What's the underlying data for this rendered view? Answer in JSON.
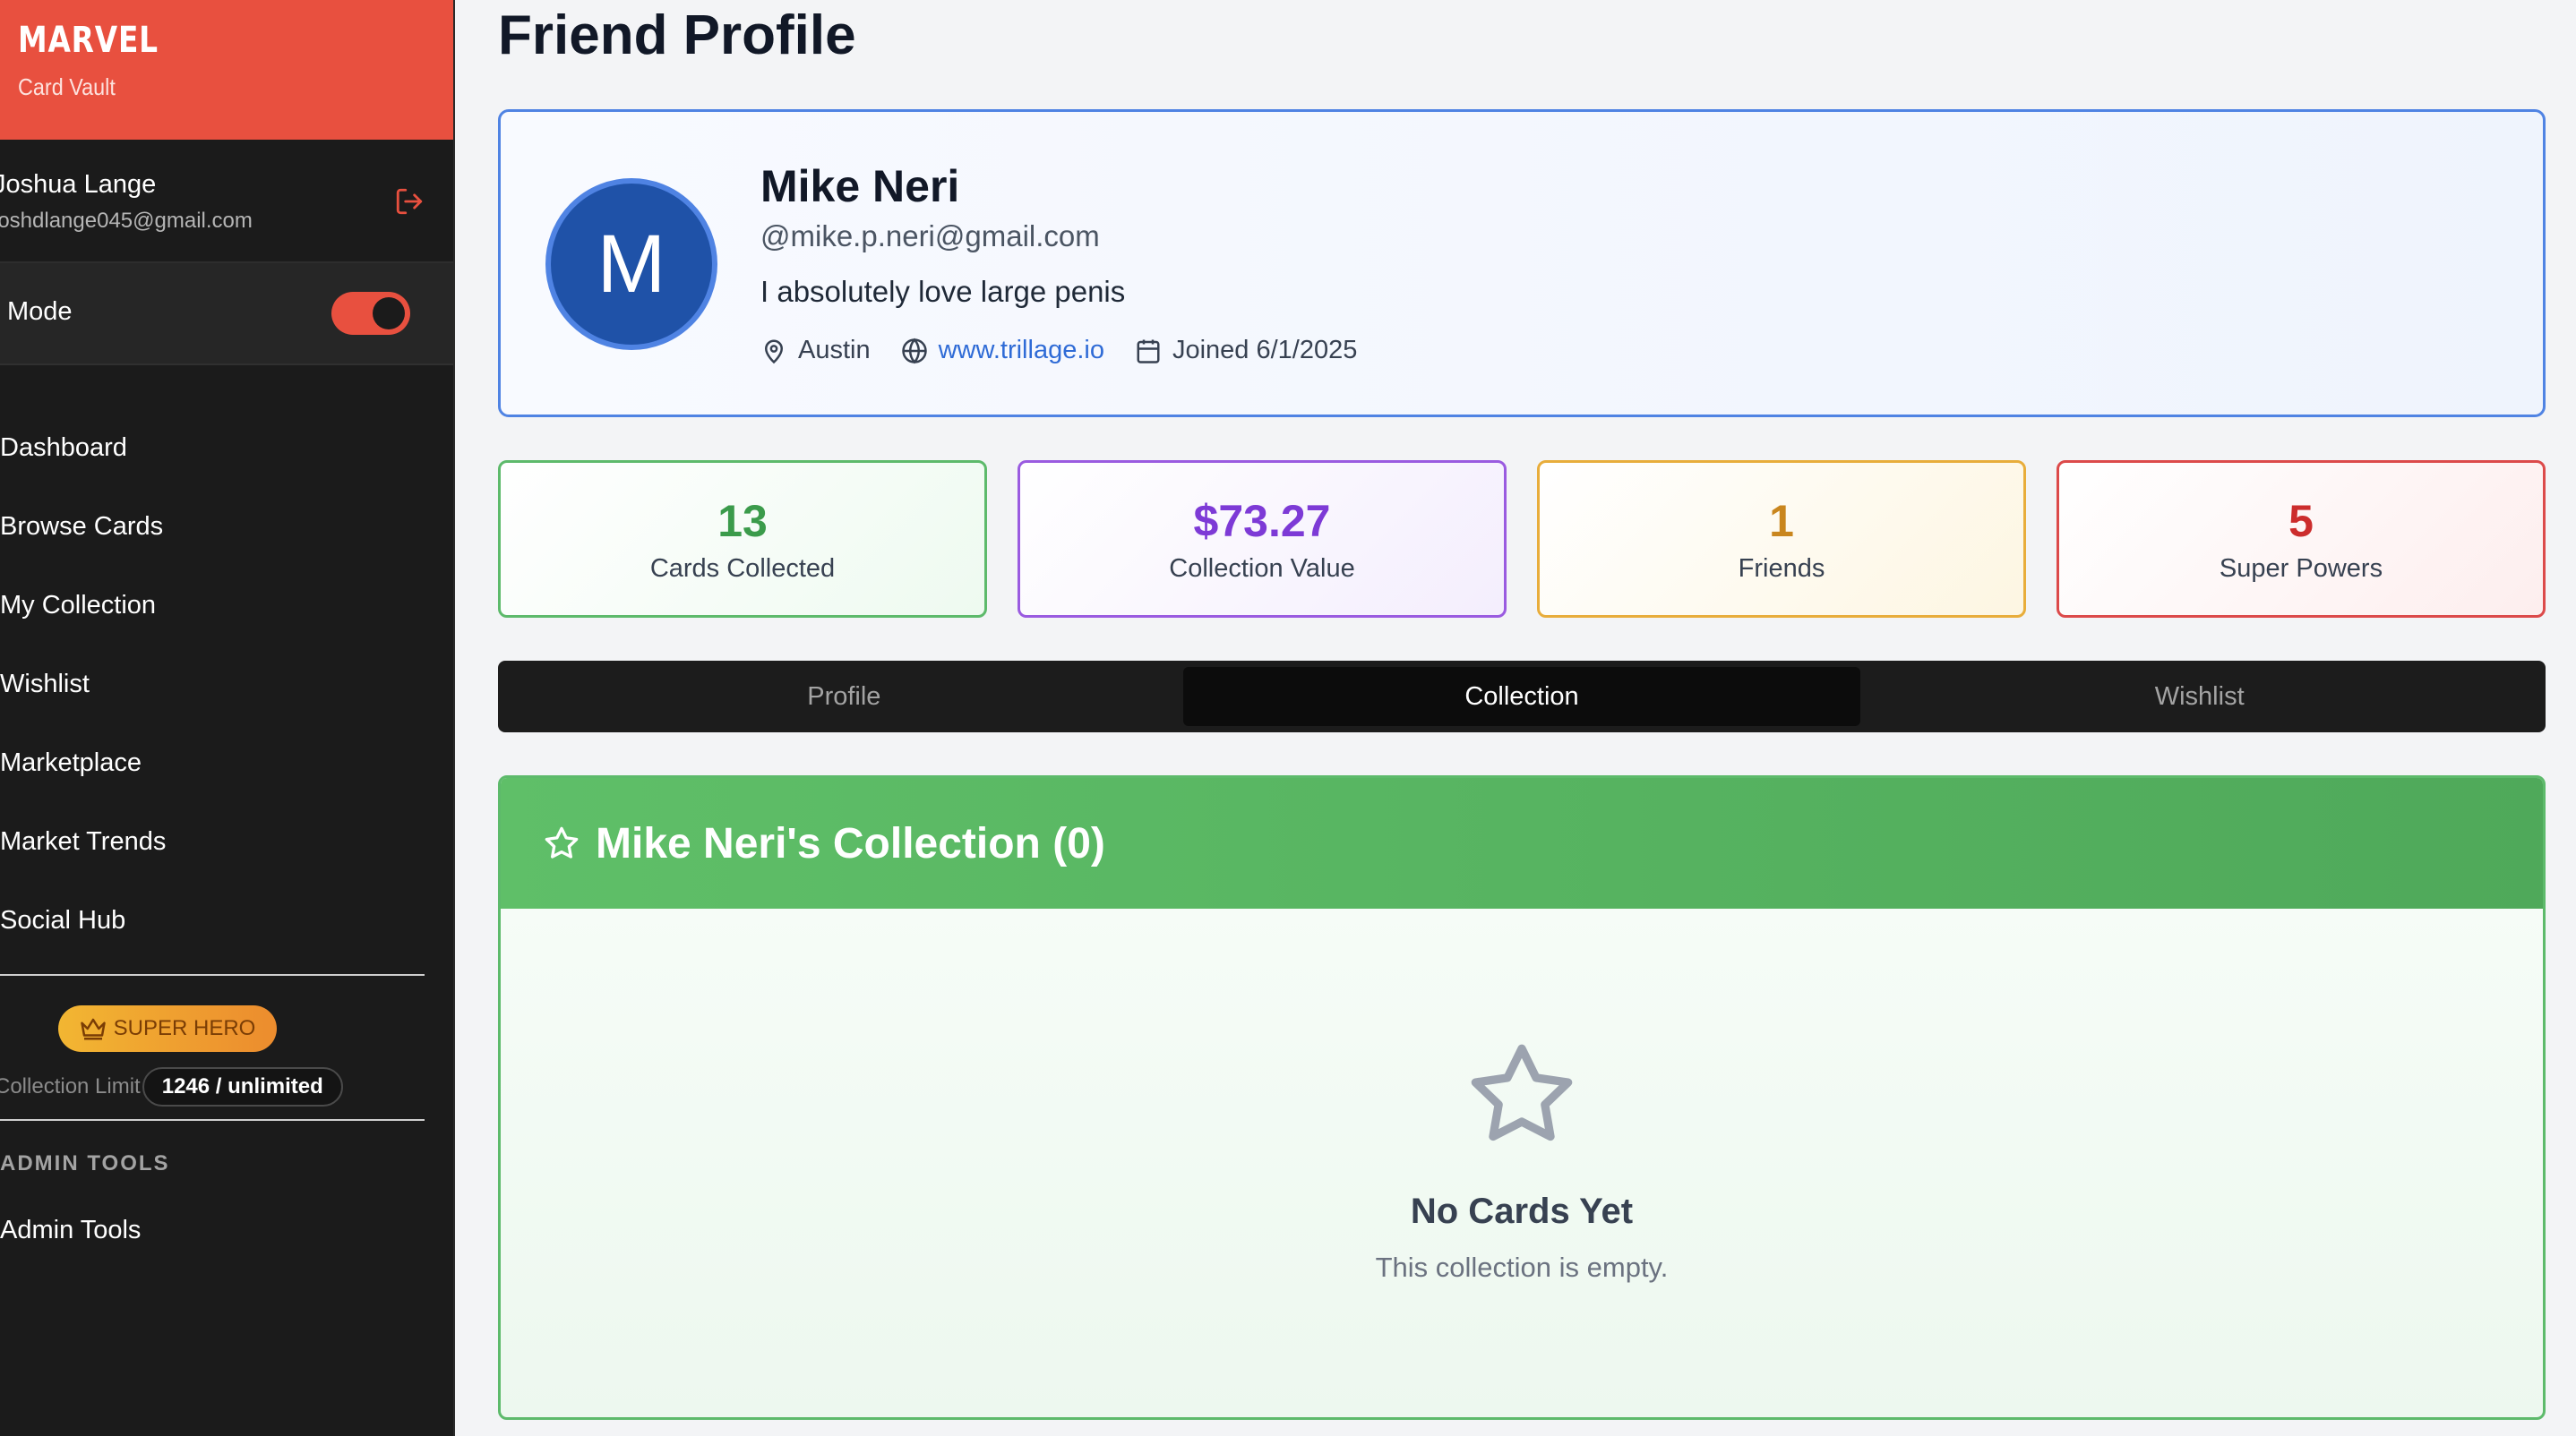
{
  "brand": {
    "logo": "MARVEL",
    "subtitle": "Card Vault",
    "accent": "#e8503f"
  },
  "user": {
    "name": "Joshua Lange",
    "email": "joshdlange045@gmail.com"
  },
  "mode": {
    "label": "Mode",
    "enabled": true
  },
  "nav": [
    {
      "label": "Dashboard"
    },
    {
      "label": "Browse Cards"
    },
    {
      "label": "My Collection"
    },
    {
      "label": "Wishlist"
    },
    {
      "label": "Marketplace"
    },
    {
      "label": "Market Trends"
    },
    {
      "label": "Social Hub"
    }
  ],
  "tier": {
    "badge": "SUPER HERO",
    "limit_label": "Collection Limit",
    "limit_value": "1246 / unlimited"
  },
  "admin": {
    "section": "ADMIN TOOLS",
    "item": "Admin Tools"
  },
  "page": {
    "title": "Friend Profile"
  },
  "profile": {
    "avatar_letter": "M",
    "name": "Mike Neri",
    "handle": "@mike.p.neri@gmail.com",
    "bio": "I absolutely love large penis",
    "location": "Austin",
    "website": "www.trillage.io",
    "joined": "Joined 6/1/2025"
  },
  "stats": [
    {
      "value": "13",
      "label": "Cards Collected",
      "color": "#3b9b4b"
    },
    {
      "value": "$73.27",
      "label": "Collection Value",
      "color": "#7d3ad6"
    },
    {
      "value": "1",
      "label": "Friends",
      "color": "#c9861e"
    },
    {
      "value": "5",
      "label": "Super Powers",
      "color": "#cc2d2d"
    }
  ],
  "tabs": [
    {
      "label": "Profile",
      "active": false
    },
    {
      "label": "Collection",
      "active": true
    },
    {
      "label": "Wishlist",
      "active": false
    }
  ],
  "collection": {
    "title": "Mike Neri's Collection (0)",
    "empty_title": "No Cards Yet",
    "empty_subtitle": "This collection is empty."
  }
}
